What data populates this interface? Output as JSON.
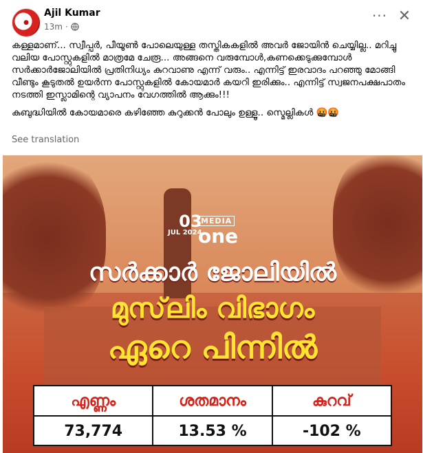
{
  "post": {
    "author": "Ajil Kumar",
    "time": "13m",
    "paragraphs": [
      "കള്ളമാണ്... സ്വീപ്പർ, പീയൂൺ പോലെയുള്ള തസ്തികകളിൽ അവർ ജോയിൻ ചെയ്യില്ല.. മറിച്ചു വലിയ പോസ്റ്റുകളിൽ മാത്രമേ ചേരൂ... അങ്ങനെ വരുമ്പോൾ,കണക്കെടുക്കുമ്പോൾ സർക്കാർജോലിയിൽ പ്രതിനിധ്യം കുറവാണു എന്ന് വരും.. എന്നിട്ട് ഇരവാദം പറഞ്ഞു മോങ്ങി വീണ്ടും കൂടുതൽ ഉയർന്ന പോസ്റ്റുകളിൽ കോയമാർ കയറി ഇരിക്കും.. എന്നിട്ട് സ്വജനപക്ഷപാതം നടത്തി ഇസ്ലാമിന്റെ വ്യാപനം വേഗത്തിൽ ആക്കും!!!",
      "കുബുദ്ധിയിൽ കോയമാരെ കഴിഞ്ഞേ കുറുക്കൻ പോലും ഉള്ളൂ.. സ്മെല്ലികൾ 🤬🤬"
    ],
    "see_translation": "See translation",
    "more_icon_text": "···",
    "close_icon_text": "✕"
  },
  "image": {
    "date_day": "03",
    "date_month_year": "JUL 2024",
    "logo_top": "MEDIA",
    "logo_main": "one",
    "headline_1": "സർക്കാർ ജോലിയിൽ",
    "headline_2": "മുസ്‌ലിം വിഭാഗം",
    "headline_3": "ഏറെ പിന്നിൽ",
    "table_headers": [
      "എണ്ണം",
      "ശതമാനം",
      "കുറവ്"
    ],
    "table_values": [
      "73,774",
      "13.53 %",
      "-102 %"
    ]
  },
  "colors": {
    "headline_yellow": "#ffe431",
    "header_red": "#d3231a"
  }
}
